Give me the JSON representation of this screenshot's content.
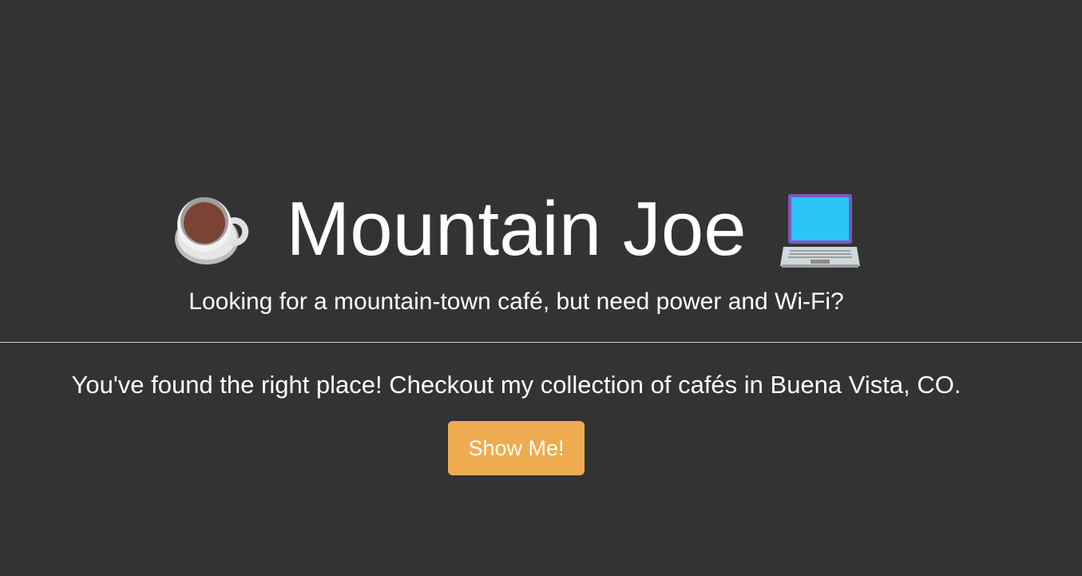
{
  "hero": {
    "left_icon": "hot-beverage-icon",
    "title": "Mountain Joe",
    "right_icon": "laptop-icon",
    "subtitle": "Looking for a mountain-town café, but need power and Wi-Fi?"
  },
  "main": {
    "lead": "You've found the right place! Checkout my collection of cafés in Buena Vista, CO.",
    "cta_label": "Show Me!"
  },
  "colors": {
    "background": "#333333",
    "text": "#ffffff",
    "button": "#efab4f",
    "divider": "#cfcfcf"
  }
}
